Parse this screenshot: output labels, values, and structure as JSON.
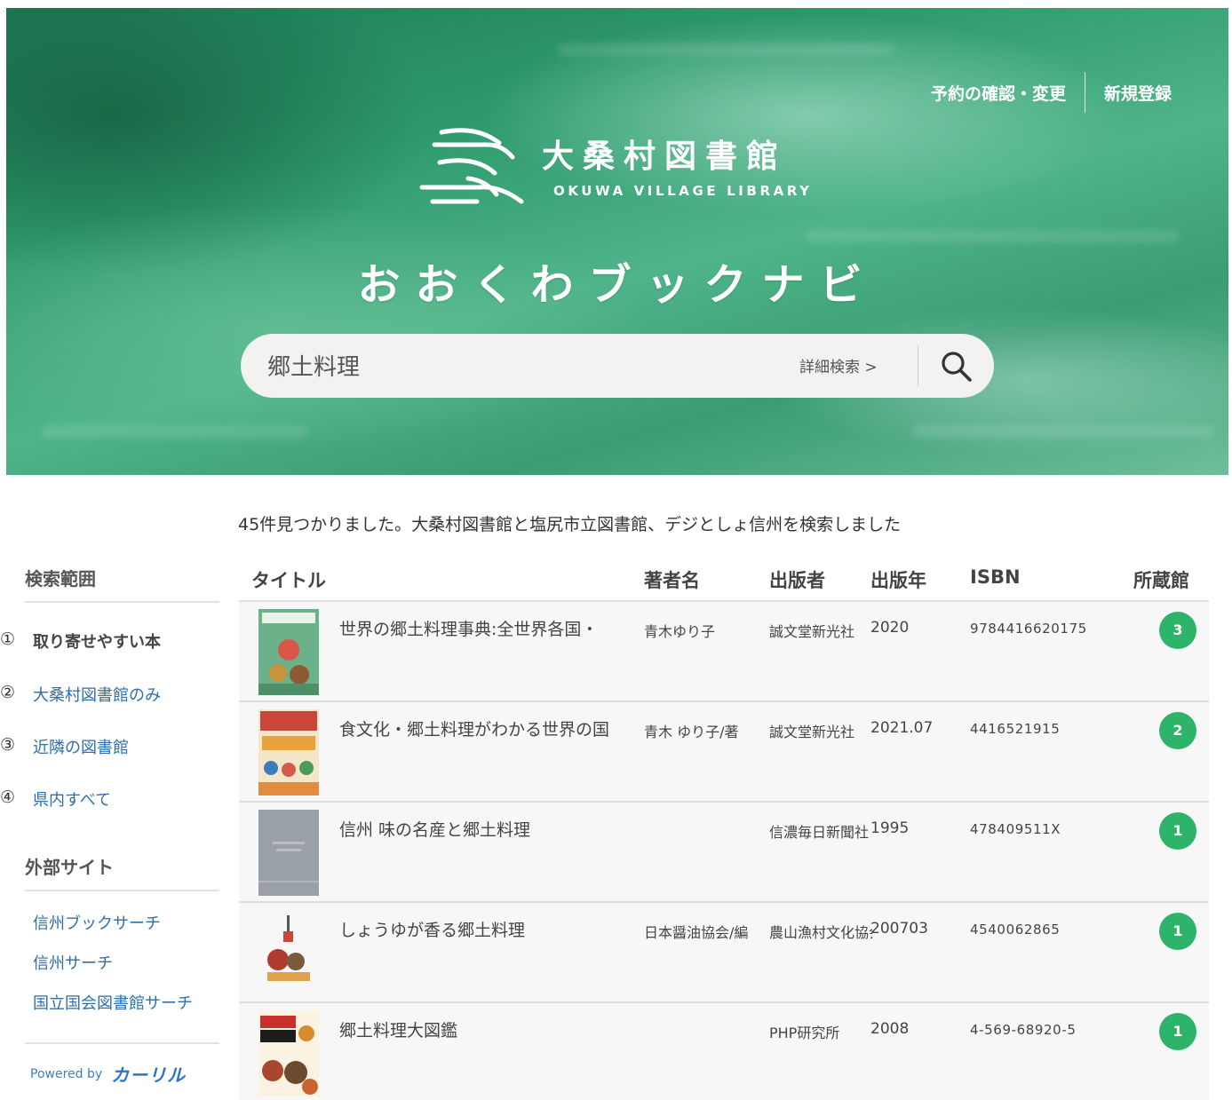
{
  "header": {
    "top_links": [
      "予約の確認・変更",
      "新規登録"
    ],
    "logo_jp": "大桑村図書館",
    "logo_en": "OKUWA VILLAGE LIBRARY",
    "site_title": "おおくわブックナビ"
  },
  "search": {
    "query": "郷土料理",
    "advanced_label": "詳細検索 >",
    "button_icon": "search-icon"
  },
  "results": {
    "summary": "45件見つかりました。大桑村図書館と塩尻市立図書館、デジとしょ信州を検索しました"
  },
  "sidebar": {
    "scope_heading": "検索範囲",
    "scope_items": [
      {
        "num": "①",
        "label": "取り寄せやすい本",
        "active": true
      },
      {
        "num": "②",
        "label": "大桑村図書館のみ",
        "active": false
      },
      {
        "num": "③",
        "label": "近隣の図書館",
        "active": false
      },
      {
        "num": "④",
        "label": "県内すべて",
        "active": false
      }
    ],
    "external_heading": "外部サイト",
    "external_links": [
      "信州ブックサーチ",
      "信州サーチ",
      "国立国会図書館サーチ"
    ],
    "powered_by": "Powered by",
    "powered_brand": "カーリル"
  },
  "table": {
    "headers": [
      "タイトル",
      "著者名",
      "出版者",
      "出版年",
      "ISBN",
      "所蔵館"
    ],
    "rows": [
      {
        "title": "世界の郷土料理事典:全世界各国・",
        "author": "青木ゆり子",
        "publisher": "誠文堂新光社",
        "year": "2020",
        "isbn": "9784416620175",
        "holdings": "3"
      },
      {
        "title": "食文化・郷土料理がわかる世界の国",
        "author": "青木 ゆり子/著",
        "publisher": "誠文堂新光社",
        "year": "2021.07",
        "isbn": "4416521915",
        "holdings": "2"
      },
      {
        "title": "信州 味の名産と郷土料理",
        "author": "",
        "publisher": "信濃毎日新聞社",
        "year": "1995",
        "isbn": "478409511X",
        "holdings": "1"
      },
      {
        "title": "しょうゆが香る郷土料理",
        "author": "日本醤油協会/編",
        "publisher": "農山漁村文化協会",
        "year": "200703",
        "isbn": "4540062865",
        "holdings": "1"
      },
      {
        "title": "郷土料理大図鑑",
        "author": "",
        "publisher": "PHP研究所",
        "year": "2008",
        "isbn": "4-569-68920-5",
        "holdings": "1"
      }
    ]
  },
  "colors": {
    "hero_green": "#2e9a6c",
    "link_blue": "#2f6fa8",
    "badge_green": "#2db36a"
  }
}
